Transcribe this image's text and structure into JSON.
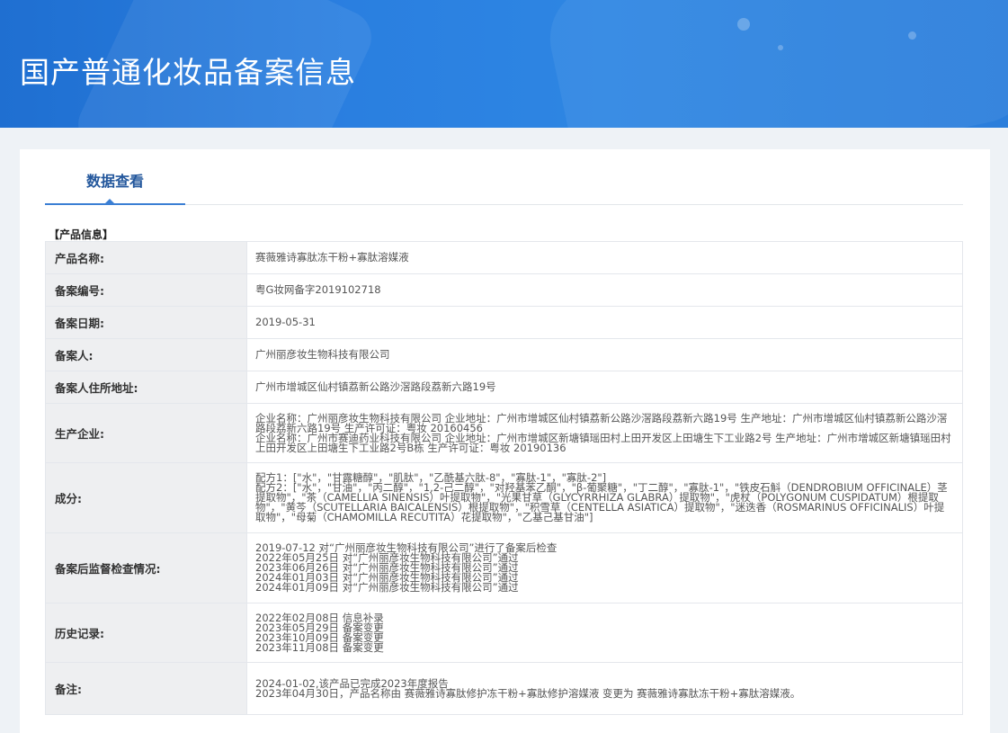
{
  "banner": {
    "title": "国产普通化妆品备案信息"
  },
  "tabs": [
    {
      "label": "数据查看"
    }
  ],
  "section": {
    "label": "【产品信息】"
  },
  "rows": [
    {
      "label": "产品名称:",
      "lines": [
        "赛薇雅诗寡肽冻干粉+寡肽溶媒液"
      ]
    },
    {
      "label": "备案编号:",
      "lines": [
        "粤G妆网备字2019102718"
      ]
    },
    {
      "label": "备案日期:",
      "lines": [
        "2019-05-31"
      ]
    },
    {
      "label": "备案人:",
      "lines": [
        "广州丽彦妆生物科技有限公司"
      ]
    },
    {
      "label": "备案人住所地址:",
      "lines": [
        "广州市增城区仙村镇荔新公路沙滘路段荔新六路19号"
      ]
    },
    {
      "label": "生产企业:",
      "lines": [
        "企业名称：广州丽彦妆生物科技有限公司 企业地址：广州市增城区仙村镇荔新公路沙滘路段荔新六路19号 生产地址：广州市增城区仙村镇荔新公路沙滘路段荔新六路19号 生产许可证：粤妆 20160456",
        "企业名称：广州市赛迪药业科技有限公司 企业地址：广州市增城区新塘镇瑶田村上田开发区上田塘生下工业路2号 生产地址：广州市增城区新塘镇瑶田村上田开发区上田塘生下工业路2号B栋 生产许可证：粤妆 20190136"
      ]
    },
    {
      "label": "成分:",
      "lines": [
        "配方1：[\"水\"，\"甘露糖醇\"，\"肌肽\"，\"乙酰基六肽-8\"，\"寡肽-1\"，\"寡肽-2\"]",
        "配方2：[\"水\"，\"甘油\"，\"丙二醇\"，\"1,2-己二醇\"，\"对羟基苯乙酮\"，\"β-葡聚糖\"，\"丁二醇\"，\"寡肽-1\"，\"铁皮石斛（DENDROBIUM OFFICINALE）茎提取物\"，\"茶（CAMELLIA SINENSIS）叶提取物\"，\"光果甘草（GLYCYRRHIZA GLABRA）提取物\"，\"虎杖（POLYGONUM CUSPIDATUM）根提取物\"，\"黄芩（SCUTELLARIA BAICALENSIS）根提取物\"，\"积雪草（CENTELLA ASIATICA）提取物\"，\"迷迭香（ROSMARINUS OFFICINALIS）叶提取物\"，\"母菊（CHAMOMILLA RECUTITA）花提取物\"，\"乙基己基甘油\"]"
      ]
    },
    {
      "label": "备案后监督检查情况:",
      "lines": [
        "2019-07-12 对“广州丽彦妆生物科技有限公司”进行了备案后检查",
        "2022年05月25日 对“广州丽彦妆生物科技有限公司”通过",
        "2023年06月26日 对“广州丽彦妆生物科技有限公司”通过",
        "2024年01月03日 对“广州丽彦妆生物科技有限公司”通过",
        "2024年01月09日 对“广州丽彦妆生物科技有限公司”通过"
      ]
    },
    {
      "label": "历史记录:",
      "lines": [
        "2022年02月08日 信息补录",
        "2023年05月29日 备案变更",
        "2023年10月09日 备案变更",
        "2023年11月08日 备案变更"
      ]
    },
    {
      "label": "备注:",
      "lines": [
        "2024-01-02,该产品已完成2023年度报告",
        "2023年04月30日，产品名称由 赛薇雅诗寡肽修护冻干粉+寡肽修护溶媒液 变更为 赛薇雅诗寡肽冻干粉+寡肽溶媒液。"
      ]
    }
  ]
}
